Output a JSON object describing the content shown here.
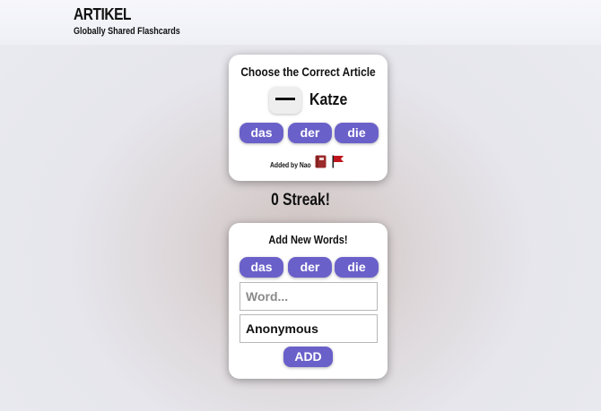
{
  "header": {
    "title": "ARTIKEL",
    "subtitle": "Globally Shared Flashcards"
  },
  "quiz": {
    "title": "Choose the Correct Article",
    "word": "Katze",
    "articles": [
      "das",
      "der",
      "die"
    ],
    "added_by": "Added by Nao",
    "icons": [
      "book-icon",
      "flag-icon"
    ]
  },
  "streak": "0 Streak!",
  "add": {
    "title": "Add New Words!",
    "articles": [
      "das",
      "der",
      "die"
    ],
    "word_placeholder": "Word...",
    "author_value": "Anonymous",
    "add_label": "ADD"
  },
  "colors": {
    "accent": "#6a60c9",
    "flag": "#c0141c",
    "book": "#9b2a2a"
  }
}
